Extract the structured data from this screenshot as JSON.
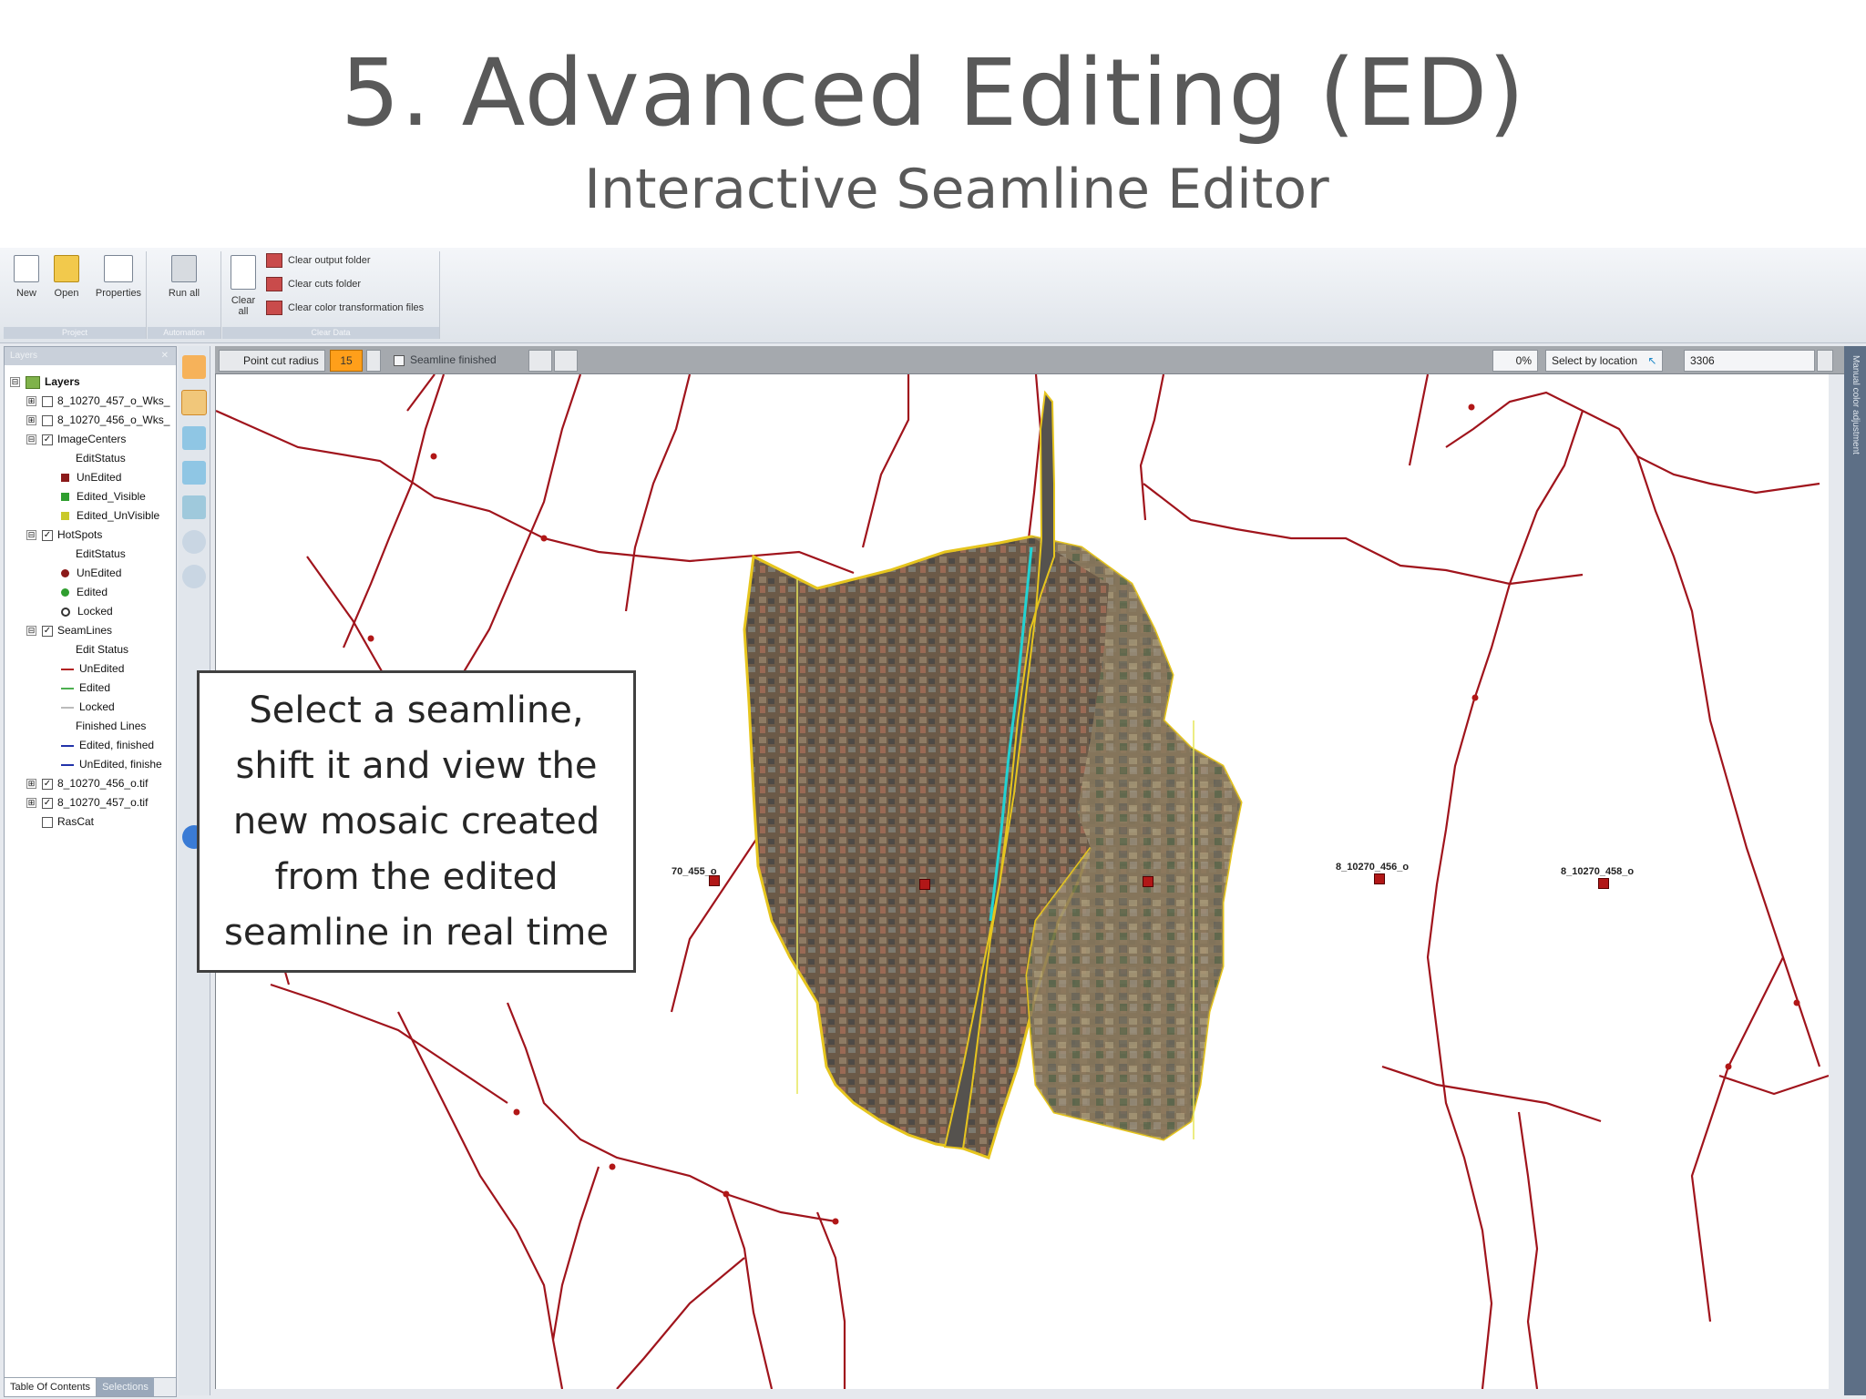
{
  "slide": {
    "title": "5. Advanced Editing (ED)",
    "subtitle": "Interactive Seamline Editor",
    "callout": "Select a seamline, shift it and view the new mosaic created from the edited seamline in real time"
  },
  "ribbon": {
    "buttons": {
      "new": "New",
      "open": "Open",
      "properties": "Properties",
      "run_all": "Run all",
      "clear_all": "Clear all"
    },
    "clear_items": [
      "Clear output folder",
      "Clear cuts folder",
      "Clear color transformation files"
    ],
    "group_labels": [
      "Project",
      "Automation",
      "Clear Data"
    ]
  },
  "layers_panel": {
    "title": "Layers",
    "tree": [
      {
        "type": "root",
        "label": "Layers",
        "expander": "⊟"
      },
      {
        "type": "layer",
        "label": "8_10270_457_o_Wks_",
        "expander": "⊞",
        "checked": false
      },
      {
        "type": "layer",
        "label": "8_10270_456_o_Wks_",
        "expander": "⊞",
        "checked": false
      },
      {
        "type": "layer",
        "label": "ImageCenters",
        "expander": "⊟",
        "checked": true
      },
      {
        "type": "caption",
        "label": "EditStatus"
      },
      {
        "type": "symbol",
        "label": "UnEdited",
        "symbol": "square",
        "color": "#8b1a1a"
      },
      {
        "type": "symbol",
        "label": "Edited_Visible",
        "symbol": "square",
        "color": "#2f9e2f"
      },
      {
        "type": "symbol",
        "label": "Edited_UnVisible",
        "symbol": "square",
        "color": "#c9c92a"
      },
      {
        "type": "layer",
        "label": "HotSpots",
        "expander": "⊟",
        "checked": true
      },
      {
        "type": "caption",
        "label": "EditStatus"
      },
      {
        "type": "symbol",
        "label": "UnEdited",
        "symbol": "dot",
        "color": "#8b1a1a"
      },
      {
        "type": "symbol",
        "label": "Edited",
        "symbol": "dot",
        "color": "#2f9e2f"
      },
      {
        "type": "symbol",
        "label": "Locked",
        "symbol": "ring",
        "color": "#333333"
      },
      {
        "type": "layer",
        "label": "SeamLines",
        "expander": "⊟",
        "checked": true
      },
      {
        "type": "caption",
        "label": "Edit Status"
      },
      {
        "type": "symbol",
        "label": "UnEdited",
        "symbol": "line",
        "color": "#b22222"
      },
      {
        "type": "symbol",
        "label": "Edited",
        "symbol": "line",
        "color": "#4caf50"
      },
      {
        "type": "symbol",
        "label": "Locked",
        "symbol": "line",
        "color": "#bbbbbb"
      },
      {
        "type": "caption",
        "label": "Finished Lines"
      },
      {
        "type": "symbol",
        "label": "Edited, finished",
        "symbol": "line",
        "color": "#2233aa"
      },
      {
        "type": "symbol",
        "label": "UnEdited, finishe",
        "symbol": "line",
        "color": "#2233aa"
      },
      {
        "type": "layer",
        "label": "8_10270_456_o.tif",
        "expander": "⊞",
        "checked": true
      },
      {
        "type": "layer",
        "label": "8_10270_457_o.tif",
        "expander": "⊞",
        "checked": true
      },
      {
        "type": "layer",
        "label": "RasCat",
        "expander": "",
        "checked": false
      }
    ],
    "tabs": [
      "Table Of Contents",
      "Selections"
    ]
  },
  "map_toolbar": {
    "point_cut_radius_label": "Point cut radius",
    "point_cut_radius_value": "15",
    "seamline_finished_label": "Seamline finished",
    "opacity_value": "0%",
    "select_by_location_label": "Select by location",
    "feature_id_value": "3306"
  },
  "map": {
    "image_labels": [
      "70_455_o",
      "8_10270_456_o",
      "8_10270_458_o"
    ]
  },
  "right_strip": {
    "label": "Manual color adjustment"
  },
  "colors": {
    "seamline": "#a0141c",
    "edited_boundary": "#e6c51e",
    "shifted_seamline": "#22d3d3",
    "accent_orange": "#ff9f1a"
  }
}
